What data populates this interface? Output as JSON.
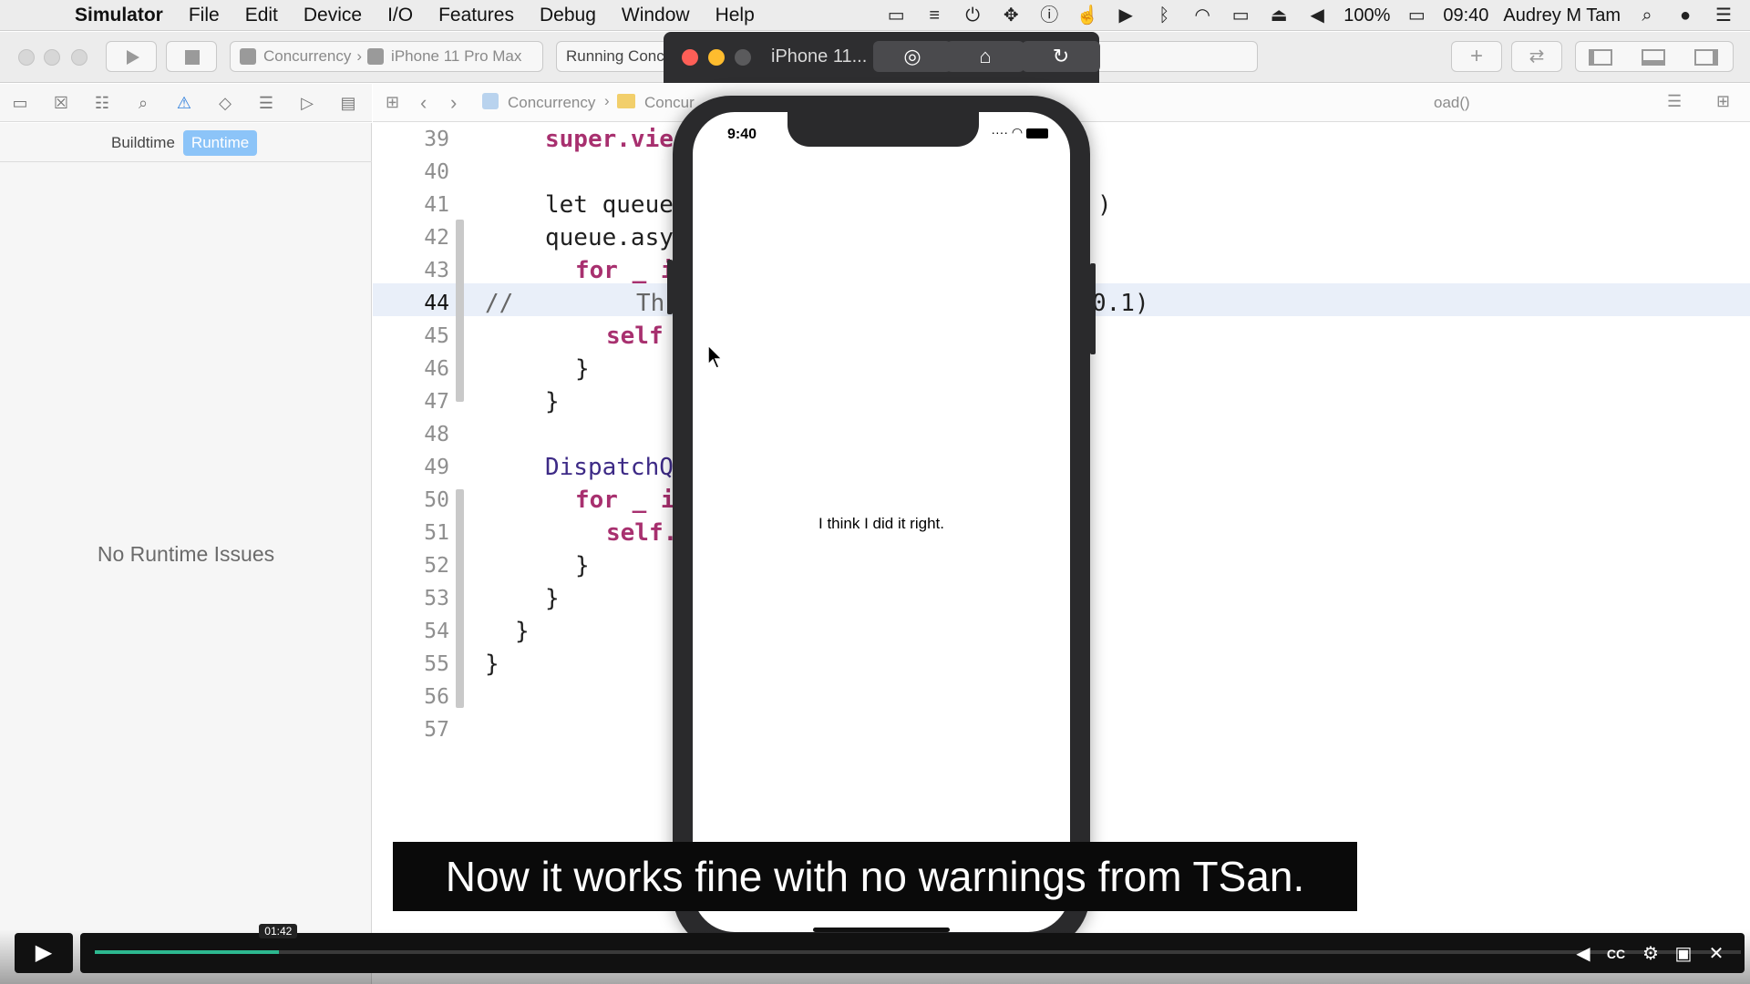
{
  "menubar": {
    "app_name": "Simulator",
    "items": [
      "File",
      "Edit",
      "Device",
      "I/O",
      "Features",
      "Debug",
      "Window",
      "Help"
    ],
    "battery": "100%",
    "clock": "09:40",
    "user": "Audrey M Tam"
  },
  "toolbar": {
    "scheme": "Concurrency",
    "device": "iPhone 11 Pro Max",
    "status": "Running Conc"
  },
  "navigator": {
    "segments": [
      "Buildtime",
      "Runtime"
    ],
    "active_segment": "Runtime",
    "empty_message": "No Runtime Issues"
  },
  "jumpbar": {
    "crumbs": [
      "Concurrency",
      "Concur"
    ],
    "method": "oad()"
  },
  "editor": {
    "current_line": 44,
    "lines": [
      {
        "n": "39",
        "code": "super.vie",
        "kind": "plain"
      },
      {
        "n": "40",
        "code": "",
        "kind": "plain"
      },
      {
        "n": "41",
        "code": "let queue",
        "kind": "plain"
      },
      {
        "n": "42",
        "code": "queue.asy",
        "kind": "plain"
      },
      {
        "n": "43",
        "code": "for _ i",
        "kind": "plain"
      },
      {
        "n": "44",
        "code": "//",
        "kind": "comment"
      },
      {
        "n": "45",
        "code": "self",
        "kind": "plain"
      },
      {
        "n": "46",
        "code": "}",
        "kind": "plain"
      },
      {
        "n": "47",
        "code": "}",
        "kind": "plain"
      },
      {
        "n": "48",
        "code": "",
        "kind": "plain"
      },
      {
        "n": "49",
        "code": "DispatchQ",
        "kind": "plain"
      },
      {
        "n": "50",
        "code": "for _ i",
        "kind": "plain"
      },
      {
        "n": "51",
        "code": "self.",
        "kind": "plain"
      },
      {
        "n": "52",
        "code": "}",
        "kind": "plain"
      },
      {
        "n": "53",
        "code": "}",
        "kind": "plain"
      },
      {
        "n": "54",
        "code": "}",
        "kind": "plain"
      },
      {
        "n": "55",
        "code": "}",
        "kind": "plain"
      },
      {
        "n": "56",
        "code": "",
        "kind": "plain"
      },
      {
        "n": "57",
        "code": "",
        "kind": "plain"
      }
    ],
    "line44_mid": "Th",
    "line41_tail": ")",
    "line44_tail": "0.1)"
  },
  "simulator": {
    "window_title": "iPhone 11...",
    "status_time": "9:40",
    "screen_label": "I think I did it right."
  },
  "subtitle": "Now it works fine with no warnings from TSan.",
  "video": {
    "time": "01:42",
    "progress": 0.112
  }
}
